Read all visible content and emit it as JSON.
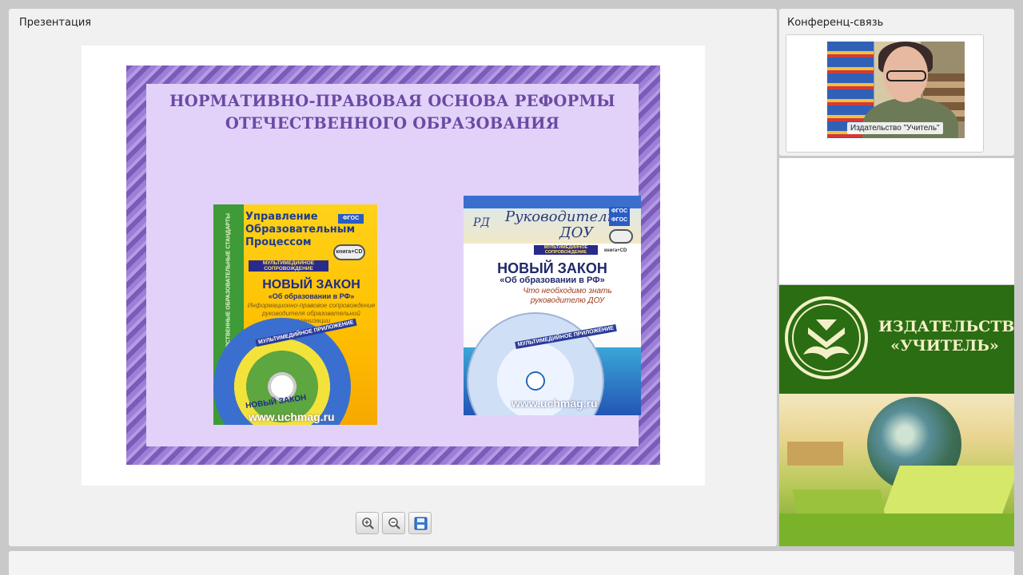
{
  "presentation": {
    "title": "Презентация",
    "slide": {
      "heading_line1": "НОРМАТИВНО-ПРАВОВАЯ ОСНОВА РЕФОРМЫ",
      "heading_line2": "ОТЕЧЕСТВЕННОГО ОБРАЗОВАНИЯ",
      "book1": {
        "spine": "ФЕДЕРАЛЬНЫЕ ГОСУДАРСТВЕННЫЕ ОБРАЗОВАТЕЛЬНЫЕ СТАНДАРТЫ",
        "series_line1": "Управление",
        "series_line2": "Образовательным",
        "series_line3": "Процессом",
        "fgos": "ФГОС",
        "cd_badge": "книга+CD",
        "mm_band": "МУЛЬТИМЕДИЙНОЕ СОПРОВОЖДЕНИЕ",
        "law_title": "НОВЫЙ ЗАКОН",
        "law_subtitle": "«Об образовании в РФ»",
        "description": "Информационно-правовое сопровождение руководителя образовательной организации",
        "disc_label": "МУЛЬТИМЕДИЙНОЕ ПРИЛОЖЕНИЕ",
        "disc_law": "НОВЫЙ ЗАКОН",
        "url": "www.uchmag.ru"
      },
      "book2": {
        "logo": "РД",
        "series_line1": "Руководителю",
        "series_line2": "ДОУ",
        "fgos": "ФГОС ФГОС",
        "cd_text": "книга+CD",
        "mm_band": "МУЛЬТИМЕДИЙНОЕ СОПРОВОЖДЕНИЕ",
        "law_title": "НОВЫЙ ЗАКОН",
        "law_subtitle": "«Об образовании в РФ»",
        "need_text": "Что необходимо знать руководителю ДОУ",
        "disc_label": "МУЛЬТИМЕДИЙНОЕ ПРИЛОЖЕНИЕ",
        "url": "www.uchmag.ru"
      }
    },
    "toolbar": {
      "zoom_in_icon": "zoom-in-icon",
      "zoom_out_icon": "zoom-out-icon",
      "save_icon": "floppy-disk-icon"
    }
  },
  "conference": {
    "title": "Конференц-связь",
    "video_caption": "Издательство \"Учитель\""
  },
  "publisher_banner": {
    "name_line1": "ИЗДАТЕЛЬСТВО",
    "name_line2": "«УЧИТЕЛЬ»"
  },
  "colors": {
    "slide_heading": "#6b4aa2",
    "banner_green": "#2b6d12",
    "banner_text": "#f3f0c8"
  }
}
